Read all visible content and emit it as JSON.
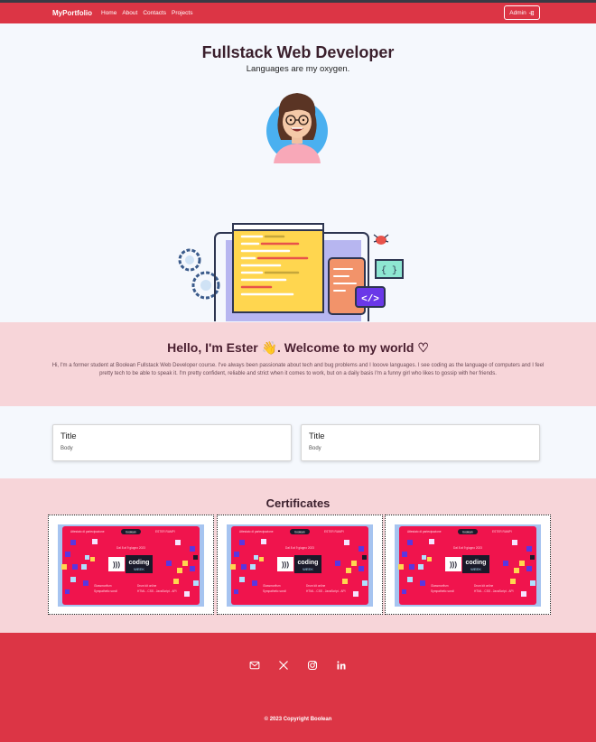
{
  "navbar": {
    "brand": "MyPortfolio",
    "links": [
      "Home",
      "About",
      "Contacts",
      "Projects"
    ],
    "admin_label": "Admin",
    "admin_icon": "box-arrow-in-right-icon"
  },
  "hero": {
    "title": "Fullstack Web Developer",
    "subtitle": "Languages are my oxygen."
  },
  "welcome": {
    "title": "Hello, I'm Ester 👋. Welcome to my world ♡",
    "text": "Hi, I'm a former student at Boolean Fullstack Web Developer course. I've always been passionate about tech and bug problems and I looove languages. I see coding as the language of computers and I feel pretty tech to be able to speak it. I'm pretty confident, reliable and strict when it comes to work, but on a daily basis I'm a funny girl who likes to gossip with her friends."
  },
  "cards": [
    {
      "title": "Title",
      "body": "Body"
    },
    {
      "title": "Title",
      "body": "Body"
    }
  ],
  "certificates": {
    "title": "Certificates",
    "items": [
      {
        "header_left": "Attestato di partecipazione",
        "header_right": "ESTER RAMPI",
        "brand": "boolean",
        "date": "Dal 8 al 9 giugno 2023",
        "logo_word1": "coding",
        "logo_word2": "WEEK",
        "list_left": [
          "Glassmorfism",
          "Sympathetic scroll"
        ],
        "list_right": [
          "Drum kit online",
          "HTML - CSS - JavaScript - API"
        ]
      },
      {
        "header_left": "Attestato di partecipazione",
        "header_right": "ESTER RAMPI",
        "brand": "boolean",
        "date": "Dal 8 al 9 giugno 2023",
        "logo_word1": "coding",
        "logo_word2": "WEEK",
        "list_left": [
          "Glassmorfism",
          "Sympathetic scroll"
        ],
        "list_right": [
          "Drum kit online",
          "HTML - CSS - JavaScript - API"
        ]
      },
      {
        "header_left": "Attestato di partecipazione",
        "header_right": "ESTER RAMPI",
        "brand": "boolean",
        "date": "Dal 8 al 9 giugno 2023",
        "logo_word1": "coding",
        "logo_word2": "WEEK",
        "list_left": [
          "Glassmorfism",
          "Sympathetic scroll"
        ],
        "list_right": [
          "Drum kit online",
          "HTML - CSS - JavaScript - API"
        ]
      }
    ]
  },
  "footer": {
    "social_icons": [
      "envelope-icon",
      "x-twitter-icon",
      "instagram-icon",
      "linkedin-icon"
    ],
    "copyright": "© 2023 Copyright Boolean"
  },
  "colors": {
    "primary": "#dc3545",
    "pink_section": "#f7d5d9",
    "light_bg": "#f5f8fd",
    "cert_bg": "#f0144d"
  }
}
